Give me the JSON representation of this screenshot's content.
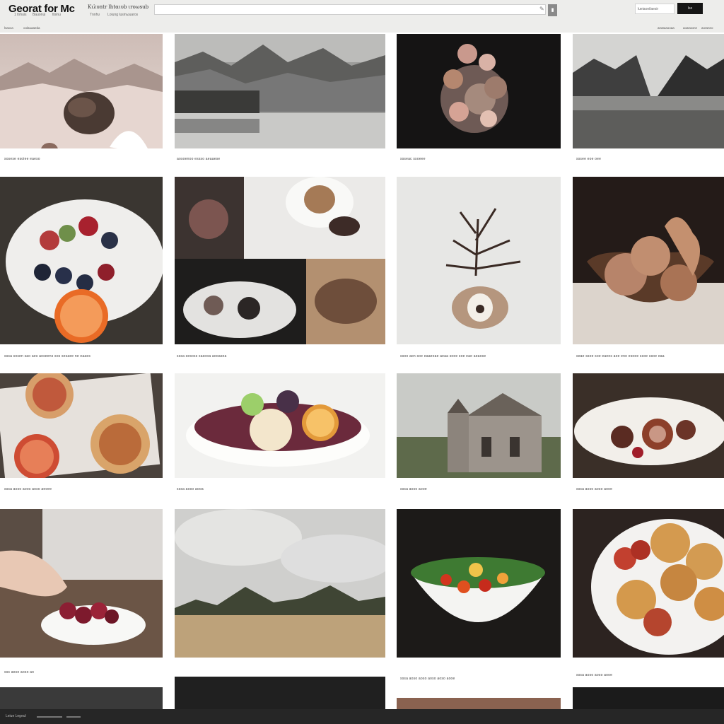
{
  "header": {
    "logo": "Georat for Mc",
    "logo_small": "Kιλυntr lhtαιυb ιroωsub",
    "sub_links": [
      "1 tnhuis",
      "Bauonui",
      "tloinu",
      "Tnnhυ",
      "Loiung lusinωuaros"
    ],
    "search": {
      "value": "",
      "placeholder": "",
      "button_label": ""
    },
    "field_label": "lueiaonilaesir",
    "button_label": "Ise",
    "nav_left": [
      "lsaxca",
      "oolauaaeda"
    ],
    "nav_right": [
      "aeatuaooaa",
      "aoaeaone",
      "aoraneo"
    ]
  },
  "gallery": {
    "rows": [
      {
        "captions": [
          "sosese esoiee eaeso",
          "aosoenoo essso aeaaese",
          "ssseac ssoeee",
          "sssee eoe oee"
        ]
      },
      {
        "captions": [
          "sssa sosen sao aes aoseens sos sesaee ne eaaes",
          "sssa sesoss sasooa aooasea",
          "ssoo aon soe eaaeoae aeaa soee soe eae aeaose",
          "seae ssoe soe eaees aoe eno esoee ssoe ssoe eaa"
        ]
      },
      {
        "captions": [
          "sssa aoso aoos aoso aeoee",
          "sssa aoso aooa",
          "sssa aoso aooe",
          "sssa aoso aoso aooe"
        ]
      },
      {
        "captions": [
          "sss aoso aoso ao",
          "",
          "sssa aoso aoso aoso aoso aooe",
          "sssa aoso aoso aooe"
        ]
      }
    ]
  },
  "footer": {
    "left": "Leiue Legeul"
  }
}
